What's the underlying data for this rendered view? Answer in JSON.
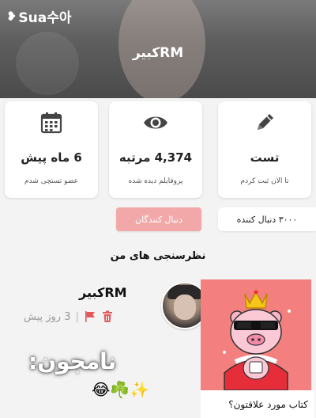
{
  "header": {
    "logo_text": "Sua수아",
    "logo_mark": "❥",
    "profile_name": "RMکبیر"
  },
  "stats": {
    "joined": {
      "value": "6 ماه پیش",
      "label": "عضو تستچی شدم",
      "icon": "calendar-icon"
    },
    "views": {
      "value": "4,374 مرتبه",
      "label": "پروفایلم دیده شده",
      "icon": "eye-icon"
    },
    "tests": {
      "value": "تست",
      "label": "تا الان ثبت کردم",
      "icon": "pencil-icon"
    }
  },
  "follow": {
    "button_label": "دنبال کنندگان",
    "followers_text": "۳۰۰۰ دنبال کننده"
  },
  "section": {
    "title": "نظرسنجی های من"
  },
  "post": {
    "author": "RMکبیر",
    "time": "3 روز پیش",
    "separator": "|",
    "quiz_caption": "کتاب مورد علاقتون؟"
  },
  "overlay": {
    "text": "نامجون:",
    "emoji": "😂☘️✨"
  },
  "colors": {
    "accent_pink": "#f2a8a8",
    "trash_red": "#e05a5a",
    "sticker_bg": "#f37f7f"
  }
}
